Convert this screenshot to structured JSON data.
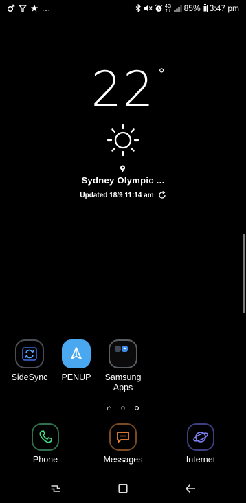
{
  "status_bar": {
    "left_icons": [
      "mars-icon",
      "wifi-calling-icon",
      "star-icon"
    ],
    "more_text": "...",
    "right_icons": [
      "bluetooth-icon",
      "mute-icon",
      "alarm-icon",
      "lte-icon",
      "signal-icon"
    ],
    "lte_label": "4G",
    "battery_percent": "85%",
    "time": "3:47 pm"
  },
  "weather": {
    "temperature": "22",
    "degree_symbol": "°",
    "condition_icon": "sun-icon",
    "location": "Sydney Olympic ...",
    "updated": "Updated 18/9 11:14 am"
  },
  "apps": [
    {
      "label": "SideSync",
      "icon": "sidesync-icon"
    },
    {
      "label": "PENUP",
      "icon": "penup-icon"
    },
    {
      "label": "Samsung Apps",
      "icon": "samsung-apps-icon"
    }
  ],
  "page_indicator": {
    "pages": 3,
    "current": 2
  },
  "dock": [
    {
      "label": "Phone",
      "icon": "phone-icon",
      "color": "#3ddc84"
    },
    {
      "label": "Messages",
      "icon": "messages-icon",
      "color": "#f0883a"
    },
    {
      "label": "Internet",
      "icon": "internet-icon",
      "color": "#7b7ff0"
    }
  ],
  "nav_bar": {
    "buttons": [
      "recent-apps-icon",
      "home-icon",
      "back-icon"
    ]
  }
}
